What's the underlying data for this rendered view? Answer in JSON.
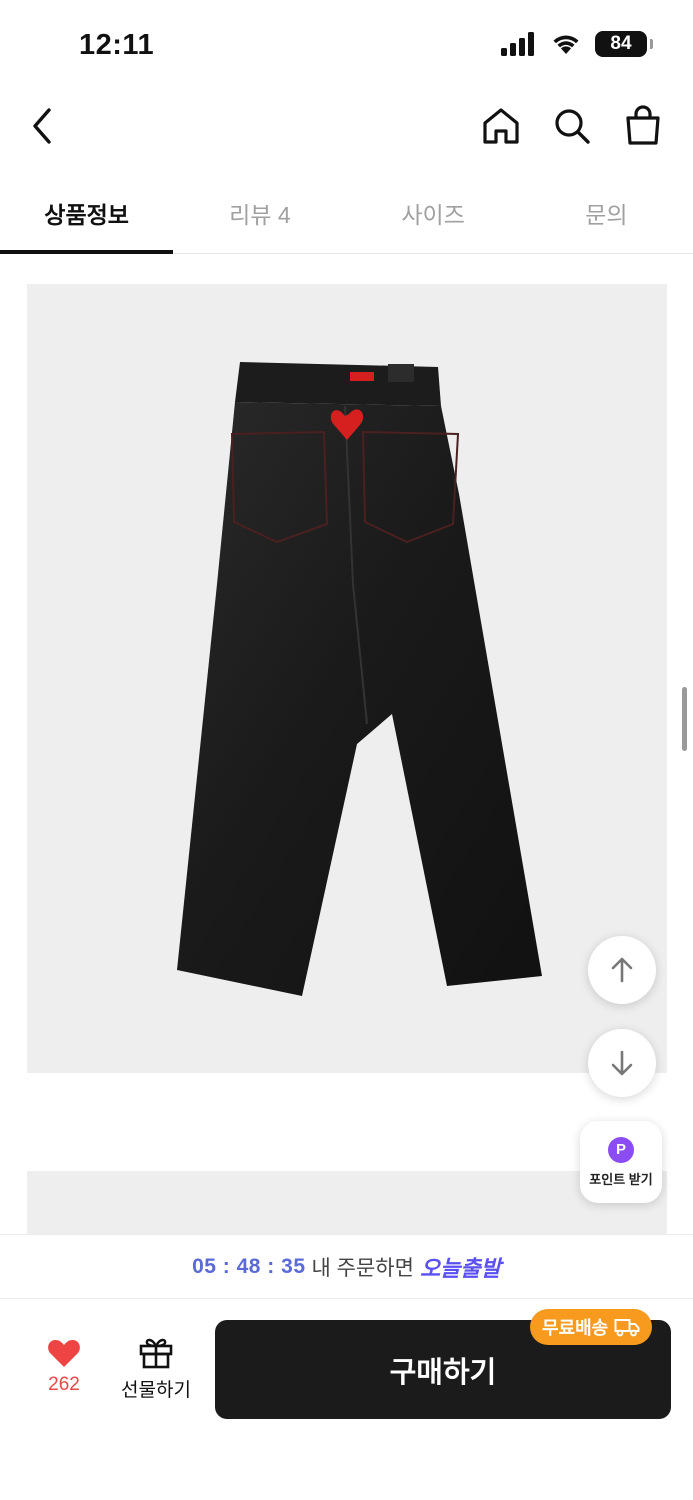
{
  "status_bar": {
    "time": "12:11",
    "battery": "84"
  },
  "nav": {
    "back_icon": "chevron-left-icon",
    "home_icon": "home-icon",
    "search_icon": "search-icon",
    "bag_icon": "shopping-bag-icon"
  },
  "tabs": [
    {
      "label": "상품정보",
      "active": true
    },
    {
      "label": "리뷰 4",
      "active": false
    },
    {
      "label": "사이즈",
      "active": false
    },
    {
      "label": "문의",
      "active": false
    }
  ],
  "product": {
    "image_icon": "black-wide-jeans-photo",
    "bg_color": "#eeeeee"
  },
  "floating": {
    "up_icon": "arrow-up-icon",
    "down_icon": "arrow-down-icon",
    "point_badge": "P",
    "point_label": "포인트 받기"
  },
  "delivery_notice": {
    "timer": "05 : 48 : 35",
    "text": "내 주문하면",
    "highlight": "오늘출발"
  },
  "bottom": {
    "like_count": "262",
    "gift_label": "선물하기",
    "buy_label": "구매하기",
    "free_shipping": "무료배송"
  },
  "colors": {
    "accent_like": "#e84848",
    "buy_button": "#1b1b1b",
    "free_ship": "#f79a1d",
    "today": "#5b50f2",
    "point": "#8b4cf3"
  }
}
